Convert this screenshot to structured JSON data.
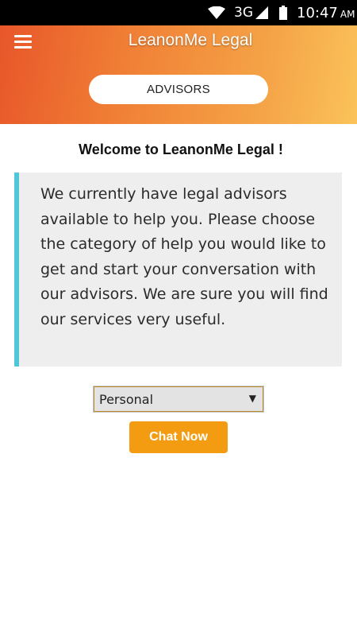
{
  "status_bar": {
    "network": "3G",
    "time": "10:47",
    "ampm": "AM",
    "icons": [
      "wifi-icon",
      "signal-icon",
      "battery-icon"
    ]
  },
  "header": {
    "title": "LeanonMe Legal",
    "menu_icon": "hamburger-menu-icon",
    "advisors_label": "ADVISORS"
  },
  "main": {
    "welcome": "Welcome to LeanonMe Legal !",
    "info": "We currently have legal advisors available to help you. Please choose the category of help you would like to get and start your conversation with our advisors. We are sure you will find our services very useful.",
    "category": {
      "selected": "Personal"
    },
    "chat_label": "Chat Now"
  },
  "colors": {
    "header_gradient_start": "#e8562a",
    "header_gradient_end": "#fbc35a",
    "info_accent": "#4fc7d8",
    "chat_button": "#f39c12"
  }
}
